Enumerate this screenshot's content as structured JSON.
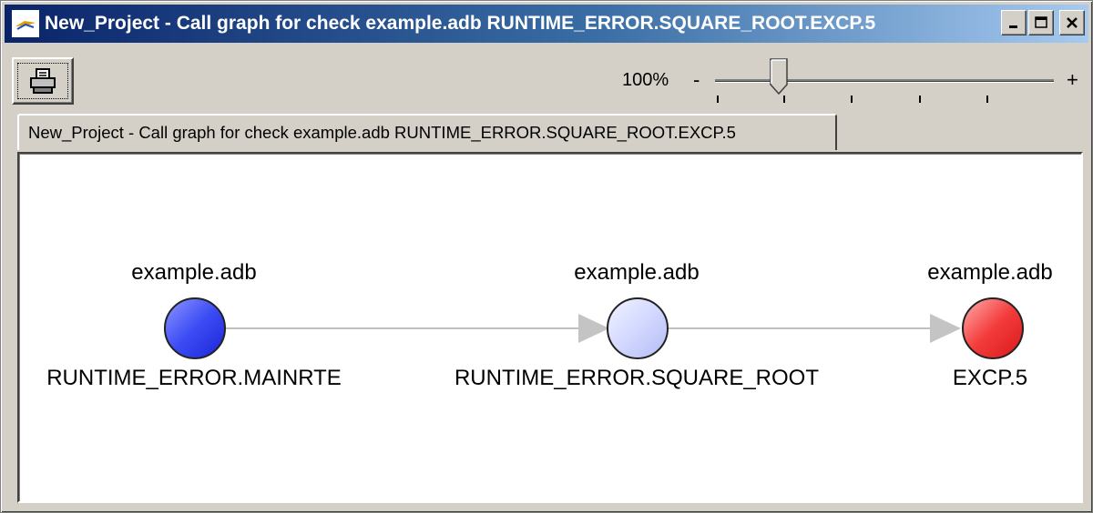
{
  "window": {
    "title": "New_Project - Call graph for check example.adb RUNTIME_ERROR.SQUARE_ROOT.EXCP.5"
  },
  "toolbar": {
    "print_icon": "printer-icon",
    "zoom_label": "100%",
    "zoom_minus": "-",
    "zoom_plus": "+",
    "zoom_level_percent": 100
  },
  "tab": {
    "label": "New_Project - Call graph for check example.adb RUNTIME_ERROR.SQUARE_ROOT.EXCP.5"
  },
  "graph": {
    "nodes": [
      {
        "file": "example.adb",
        "name": "RUNTIME_ERROR.MAINRTE",
        "color": "#2a3cf0"
      },
      {
        "file": "example.adb",
        "name": "RUNTIME_ERROR.SQUARE_ROOT",
        "color": "#c8d0ff"
      },
      {
        "file": "example.adb",
        "name": "EXCP.5",
        "color": "#f02020"
      }
    ],
    "edge_color": "#bfbfbf"
  }
}
